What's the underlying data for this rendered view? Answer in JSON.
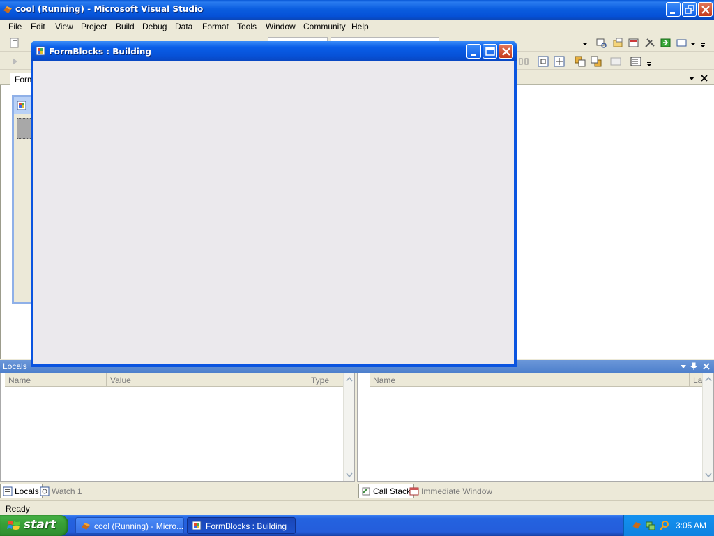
{
  "vs_window": {
    "title": "cool (Running) - Microsoft Visual Studio",
    "menu": [
      "File",
      "Edit",
      "View",
      "Project",
      "Build",
      "Debug",
      "Data",
      "Format",
      "Tools",
      "Window",
      "Community",
      "Help"
    ]
  },
  "document": {
    "tab_label": "Form"
  },
  "tool_windows": {
    "locals_title": "Locals",
    "locals_columns": [
      "Name",
      "Value",
      "Type"
    ],
    "callstack_columns": [
      "Name",
      "Lang"
    ],
    "left_tabs": [
      "Locals",
      "Watch 1"
    ],
    "right_tabs": [
      "Call Stack",
      "Immediate Window"
    ]
  },
  "status": {
    "text": "Ready"
  },
  "running_form": {
    "title": "FormBlocks : Building"
  },
  "taskbar": {
    "start_label": "start",
    "tasks": [
      "cool (Running) - Micro...",
      "FormBlocks : Building"
    ],
    "clock": "3:05 AM"
  },
  "colors": {
    "titlebar_blue": "#0a5ad8",
    "form_background": "#ebe9ed",
    "start_green": "#38a038",
    "tray_blue": "#1391f0"
  }
}
